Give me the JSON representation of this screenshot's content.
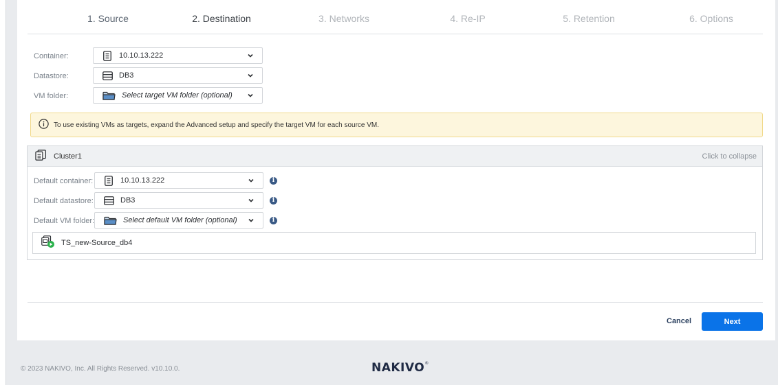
{
  "steps": [
    "1. Source",
    "2. Destination",
    "3. Networks",
    "4. Re-IP",
    "5. Retention",
    "6. Options"
  ],
  "top_form": {
    "container_label": "Container:",
    "container_value": "10.10.13.222",
    "datastore_label": "Datastore:",
    "datastore_value": "DB3",
    "vmfolder_label": "VM folder:",
    "vmfolder_placeholder": "Select target VM folder (optional)"
  },
  "alert": {
    "text": "To use existing VMs as targets, expand the Advanced setup and specify the target VM for each source VM."
  },
  "cluster": {
    "name": "Cluster1",
    "collapse_label": "Click to collapse",
    "default_container_label": "Default container:",
    "default_container_value": "10.10.13.222",
    "default_datastore_label": "Default datastore:",
    "default_datastore_value": "DB3",
    "default_vmfolder_label": "Default VM folder:",
    "default_vmfolder_placeholder": "Select default VM folder (optional)",
    "vm_name": "TS_new-Source_db4"
  },
  "actions": {
    "cancel_label": "Cancel",
    "next_label": "Next"
  },
  "footer": {
    "copyright": "© 2023 NAKIVO, Inc. All Rights Reserved. v10.10.0.",
    "logo": "NAKIVO",
    "logo_mark": "®"
  },
  "colors": {
    "primary": "#0a73e8",
    "alert_bg": "#fdf6dd",
    "alert_border": "#f1d98a",
    "info_dot": "#3a5a86",
    "vm_status": "#2bb24c"
  },
  "icons": {
    "container": "server-icon",
    "datastore": "datastore-icon",
    "vmfolder": "folder-icon",
    "alert": "info-circle-icon",
    "cluster": "cluster-icon",
    "vm": "vm-running-icon"
  }
}
